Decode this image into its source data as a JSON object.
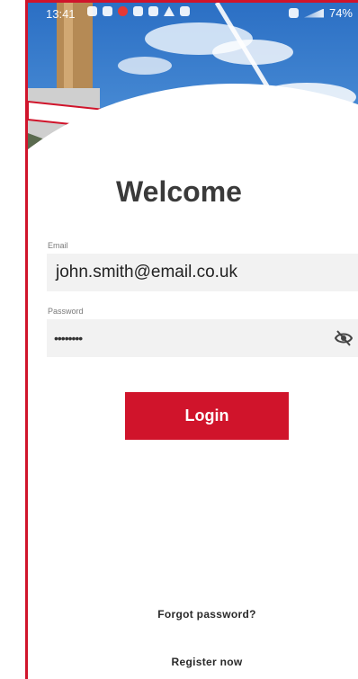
{
  "status_bar": {
    "time": "13:41",
    "battery": "74%",
    "icons": [
      "notification-icon",
      "notification-icon",
      "red-app-icon",
      "message-icon",
      "image-icon",
      "warning-icon",
      "settings-icon"
    ]
  },
  "colors": {
    "brand_red": "#d0142b",
    "field_bg": "#f2f2f2",
    "title_text": "#3a3a3a",
    "sky_blue": "#2f7fd0"
  },
  "login": {
    "title": "Welcome",
    "email_label": "Email",
    "email_value": "john.smith@email.co.uk",
    "password_label": "Password",
    "password_value": "••••••••",
    "toggle_icon": "eye-off-icon",
    "login_button": "Login",
    "forgot_password": "Forgot password?",
    "register": "Register now"
  }
}
